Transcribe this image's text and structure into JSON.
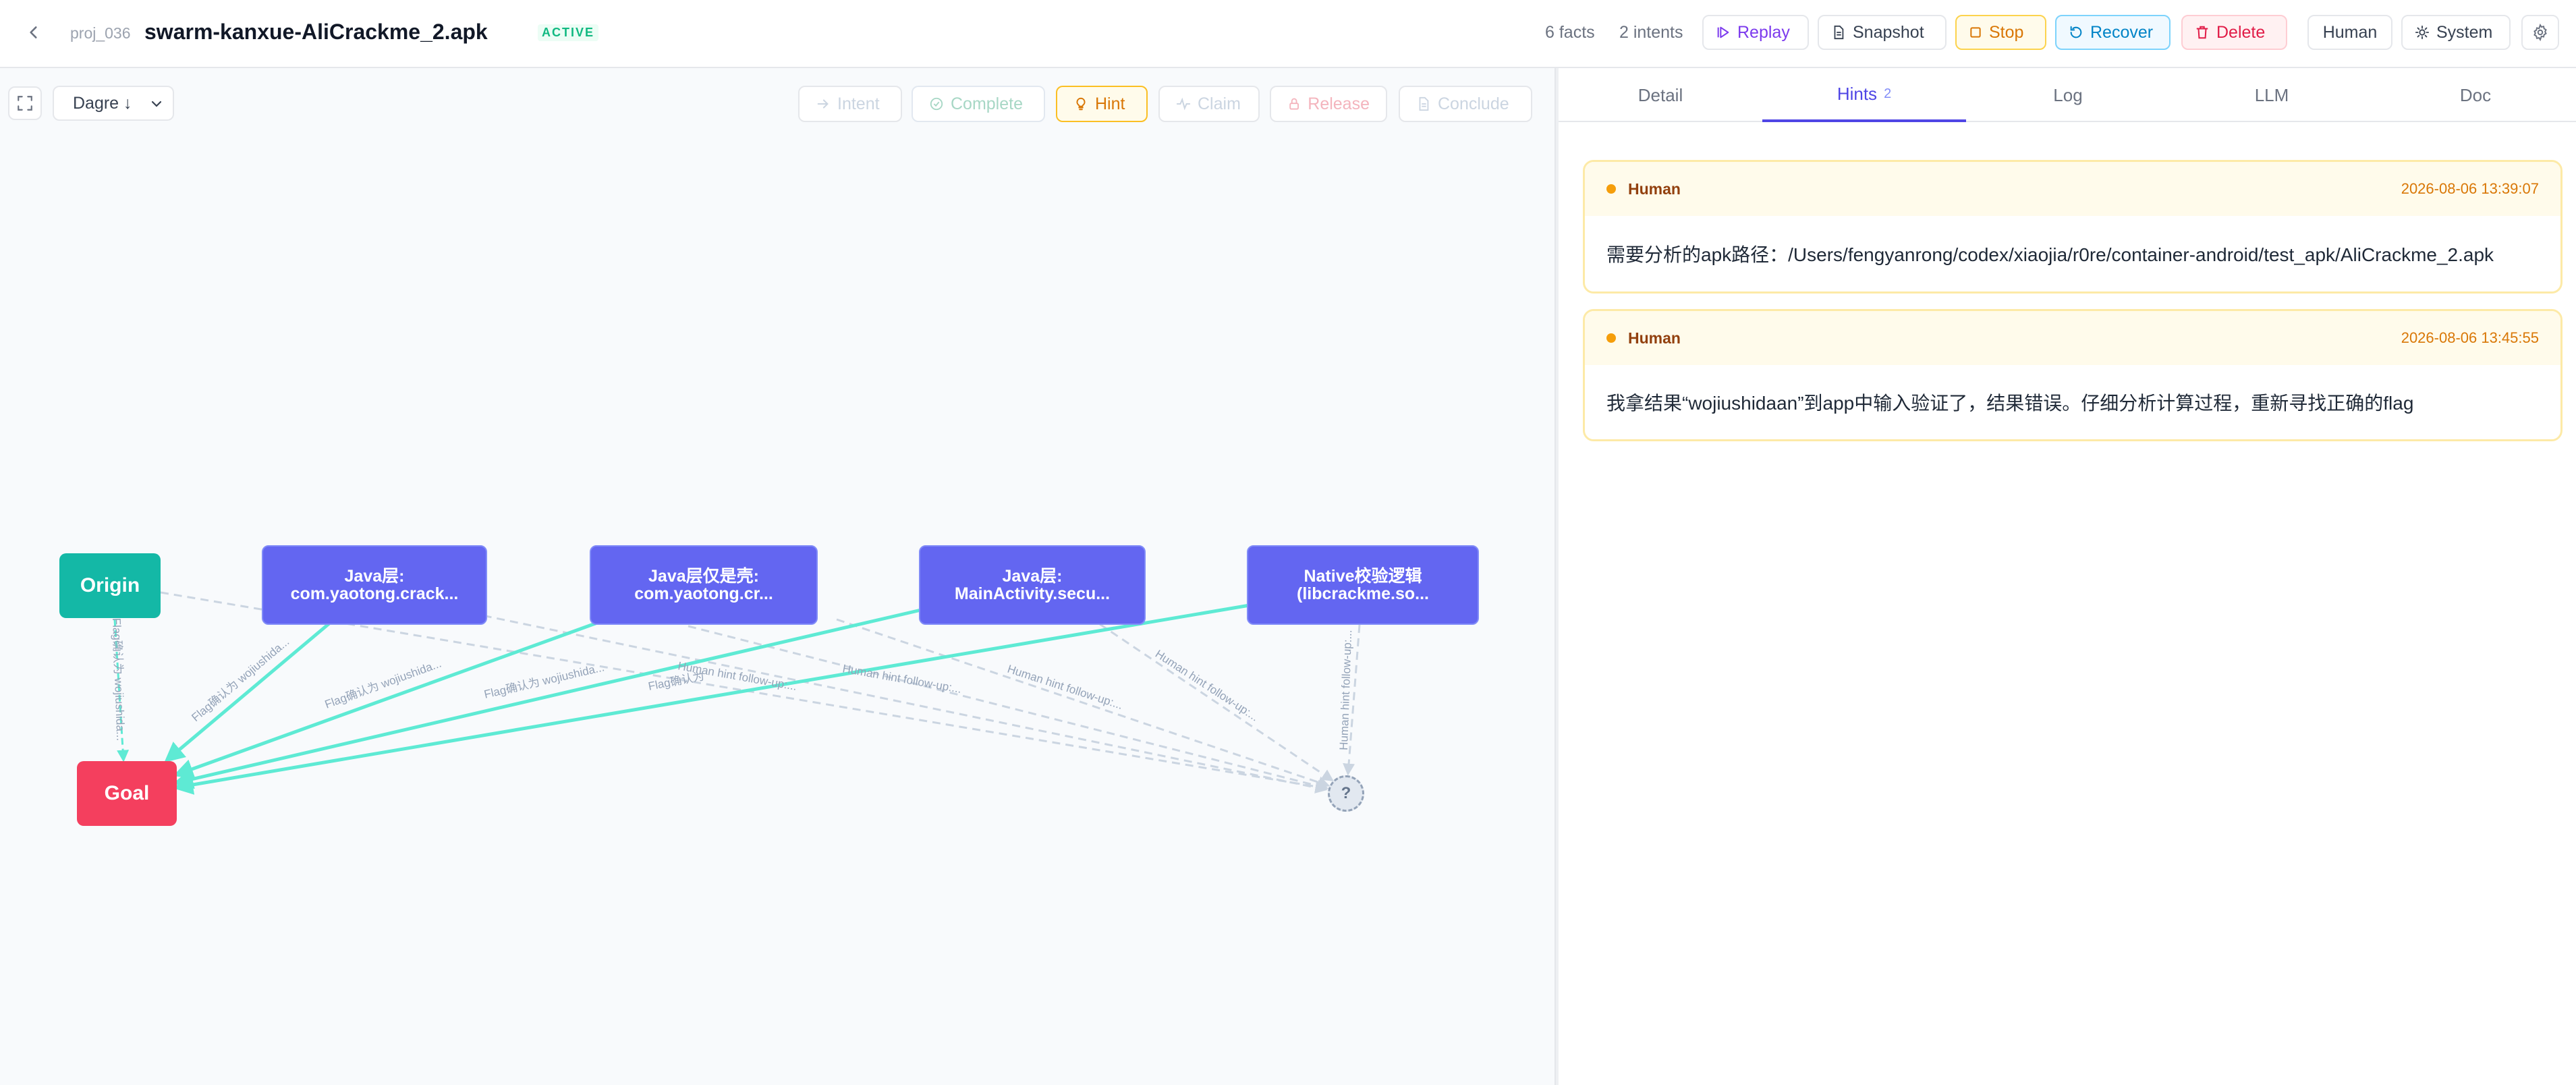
{
  "header": {
    "project_id": "proj_036",
    "project_name": "swarm-kanxue-AliCrackme_2.apk",
    "status": "ACTIVE",
    "facts": "6 facts",
    "intents": "2 intents",
    "buttons": {
      "replay": "Replay",
      "snapshot": "Snapshot",
      "stop": "Stop",
      "recover": "Recover",
      "delete": "Delete",
      "human": "Human",
      "system": "System"
    }
  },
  "canvas": {
    "layout_value": "Dagre ↓",
    "actions": {
      "intent": "Intent",
      "complete": "Complete",
      "hint": "Hint",
      "claim": "Claim",
      "release": "Release",
      "conclude": "Conclude"
    },
    "nodes": {
      "origin": "Origin",
      "goal": "Goal",
      "unknown": "?",
      "task1": "Java层: com.yaotong.crack...",
      "task2": "Java层仅是壳: com.yaotong.cr...",
      "task3": "Java层: MainActivity.secu...",
      "task4": "Native校验逻辑(libcrackme.so..."
    },
    "edge_labels": {
      "flag_full": "Flag确认为 wojiushida...",
      "flag_short": "Flag确认为",
      "flag_vertical": "Flag确认为 wojiushida...",
      "hint": "Human hint follow-up:..."
    }
  },
  "panel": {
    "tabs": [
      {
        "label": "Detail",
        "count": ""
      },
      {
        "label": "Hints",
        "count": "2"
      },
      {
        "label": "Log",
        "count": ""
      },
      {
        "label": "LLM",
        "count": ""
      },
      {
        "label": "Doc",
        "count": ""
      }
    ],
    "hints": [
      {
        "author": "Human",
        "time": "2026-08-06 13:39:07",
        "text": "需要分析的apk路径：/Users/fengyanrong/codex/xiaojia/r0re/container-android/test_apk/AliCrackme_2.apk"
      },
      {
        "author": "Human",
        "time": "2026-08-06 13:45:55",
        "text": "我拿结果“wojiushidaan”到app中输入验证了，结果错误。仔细分析计算过程，重新寻找正确的flag"
      }
    ]
  },
  "colors": {
    "accent": "#4f46e5",
    "origin": "#14b8a6",
    "goal": "#f43f5e",
    "task": "#6366f1",
    "edge_solid": "#5eead4",
    "hint": "#f59e0b"
  }
}
